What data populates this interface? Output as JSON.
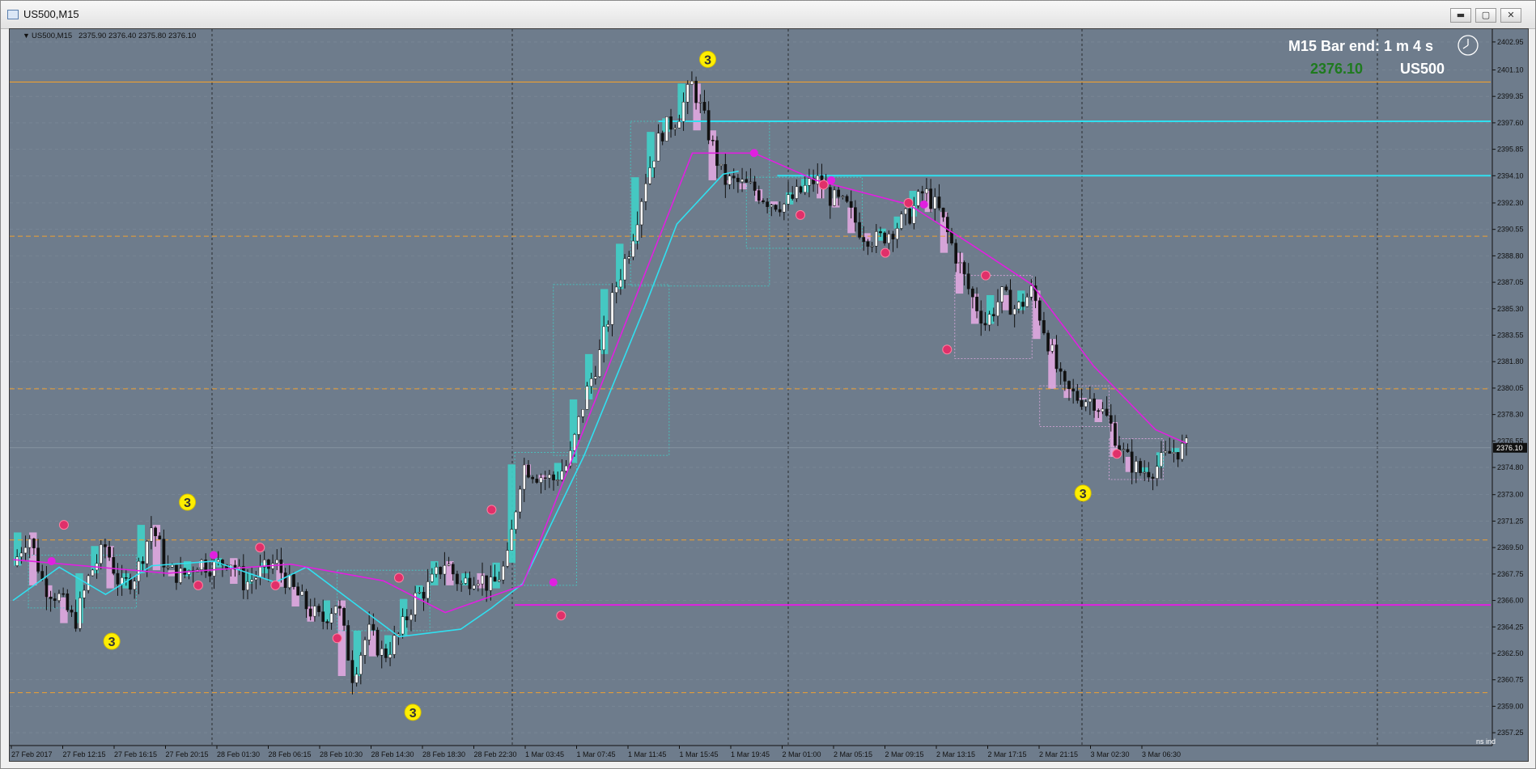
{
  "window": {
    "title": "US500,M15",
    "min_glyph": "▬",
    "max_glyph": "▢",
    "close_glyph": "✕"
  },
  "info_line": {
    "symbol": "US500,M15",
    "ohlc": "2375.90 2376.40 2375.80 2376.10"
  },
  "overlay": {
    "bar_end": "M15 Bar end: 1 m 4 s",
    "price": "2376.10",
    "symbol": "US500",
    "price_color": "#1e7a1e"
  },
  "corner_badge": "ns ind",
  "colors": {
    "background": "#6e7c8c",
    "bull": "#40d0c8",
    "bear": "#e0a8e0",
    "magenta": "#e020e0",
    "cyan": "#30e0f0",
    "orange": "#f0a030",
    "yellow": "#ffee00",
    "pivot": "#e0306a"
  },
  "chart_data": {
    "type": "candlestick",
    "title": "",
    "ylim": [
      2356.4,
      2403.8
    ],
    "y_ticks": [
      "2402.95",
      "2401.10",
      "2399.35",
      "2397.60",
      "2395.85",
      "2394.10",
      "2392.30",
      "2390.55",
      "2388.80",
      "2387.05",
      "2385.30",
      "2383.55",
      "2381.80",
      "2380.05",
      "2378.30",
      "2376.55",
      "2374.80",
      "2373.00",
      "2371.25",
      "2369.50",
      "2367.75",
      "2366.00",
      "2364.25",
      "2362.50",
      "2360.75",
      "2359.00",
      "2357.25"
    ],
    "current_price": "2376.10",
    "x_ticks": [
      "27 Feb 2017",
      "27 Feb 12:15",
      "27 Feb 16:15",
      "27 Feb 20:15",
      "28 Feb 01:30",
      "28 Feb 06:15",
      "28 Feb 10:30",
      "28 Feb 14:30",
      "28 Feb 18:30",
      "28 Feb 22:30",
      "1 Mar 03:45",
      "1 Mar 07:45",
      "1 Mar 11:45",
      "1 Mar 15:45",
      "1 Mar 19:45",
      "2 Mar 01:00",
      "2 Mar 05:15",
      "2 Mar 09:15",
      "2 Mar 13:15",
      "2 Mar 17:15",
      "2 Mar 21:15",
      "3 Mar 02:30",
      "3 Mar 06:30"
    ],
    "close_path": [
      [
        0,
        2368.3
      ],
      [
        1,
        2370.5
      ],
      [
        2,
        2367.0
      ],
      [
        3,
        2366.2
      ],
      [
        4,
        2364.5
      ],
      [
        5,
        2367.8
      ],
      [
        6,
        2369.6
      ],
      [
        7,
        2366.8
      ],
      [
        8,
        2367.8
      ],
      [
        9,
        2371.0
      ],
      [
        10,
        2368.0
      ],
      [
        11,
        2367.6
      ],
      [
        12,
        2368.6
      ],
      [
        13,
        2368.2
      ],
      [
        14,
        2368.8
      ],
      [
        15,
        2367.1
      ],
      [
        16,
        2367.8
      ],
      [
        17,
        2368.5
      ],
      [
        18,
        2366.9
      ],
      [
        19,
        2365.6
      ],
      [
        20,
        2364.6
      ],
      [
        21,
        2366.0
      ],
      [
        22,
        2361.0
      ],
      [
        23,
        2364.0
      ],
      [
        24,
        2362.3
      ],
      [
        25,
        2363.7
      ],
      [
        26,
        2366.1
      ],
      [
        27,
        2367.0
      ],
      [
        28,
        2368.6
      ],
      [
        29,
        2367.0
      ],
      [
        30,
        2367.8
      ],
      [
        31,
        2366.8
      ],
      [
        32,
        2368.5
      ],
      [
        33,
        2375.0
      ],
      [
        34,
        2374.3
      ],
      [
        35,
        2374.0
      ],
      [
        36,
        2375.1
      ],
      [
        37,
        2379.3
      ],
      [
        38,
        2382.3
      ],
      [
        39,
        2386.6
      ],
      [
        40,
        2389.6
      ],
      [
        41,
        2394.0
      ],
      [
        42,
        2397.0
      ],
      [
        43,
        2397.9
      ],
      [
        44,
        2400.2
      ],
      [
        45,
        2397.1
      ],
      [
        46,
        2393.8
      ],
      [
        47,
        2393.6
      ],
      [
        48,
        2393.2
      ],
      [
        49,
        2392.4
      ],
      [
        50,
        2392.2
      ],
      [
        51,
        2393.0
      ],
      [
        52,
        2393.9
      ],
      [
        53,
        2392.6
      ],
      [
        54,
        2392.0
      ],
      [
        55,
        2390.3
      ],
      [
        56,
        2389.8
      ],
      [
        57,
        2390.6
      ],
      [
        58,
        2391.4
      ],
      [
        59,
        2393.1
      ],
      [
        60,
        2391.7
      ],
      [
        61,
        2389.0
      ],
      [
        62,
        2386.3
      ],
      [
        63,
        2384.3
      ],
      [
        64,
        2386.2
      ],
      [
        65,
        2385.2
      ],
      [
        66,
        2386.5
      ],
      [
        67,
        2383.3
      ],
      [
        68,
        2380.0
      ],
      [
        69,
        2379.4
      ],
      [
        70,
        2379.3
      ],
      [
        71,
        2377.8
      ],
      [
        72,
        2375.5
      ],
      [
        73,
        2374.5
      ],
      [
        74,
        2374.8
      ],
      [
        75,
        2375.8
      ],
      [
        76,
        2376.1
      ]
    ],
    "n_steps": 76,
    "ma_magenta": [
      [
        0,
        2368.7
      ],
      [
        10,
        2367.8
      ],
      [
        18,
        2368.4
      ],
      [
        24,
        2367.3
      ],
      [
        28,
        2365.2
      ],
      [
        33,
        2367.0
      ],
      [
        44,
        2395.6
      ],
      [
        48,
        2395.6
      ],
      [
        52,
        2393.8
      ],
      [
        58,
        2392.2
      ],
      [
        62,
        2389.6
      ],
      [
        66,
        2386.9
      ],
      [
        70,
        2381.5
      ],
      [
        74,
        2377.3
      ],
      [
        76,
        2376.4
      ]
    ],
    "ma_cyan": [
      [
        0,
        2366.0
      ],
      [
        3,
        2368.2
      ],
      [
        6,
        2366.4
      ],
      [
        9,
        2368.3
      ],
      [
        13,
        2368.6
      ],
      [
        17,
        2367.2
      ],
      [
        19,
        2368.2
      ],
      [
        25,
        2363.6
      ],
      [
        29,
        2364.1
      ],
      [
        31,
        2365.5
      ],
      [
        33,
        2367.1
      ],
      [
        37,
        2375.6
      ],
      [
        41,
        2385.6
      ],
      [
        43,
        2390.9
      ],
      [
        46,
        2394.2
      ],
      [
        47,
        2394.4
      ]
    ],
    "hlines": [
      {
        "y": 2400.3,
        "color": "orange",
        "width": 1.2
      },
      {
        "y": 2397.7,
        "color": "cyan",
        "width": 2,
        "from": 41.8
      },
      {
        "y": 2394.1,
        "color": "cyan",
        "width": 2,
        "from": 49.5
      },
      {
        "y": 2365.7,
        "color": "magenta",
        "width": 2,
        "from": 32.5
      }
    ],
    "dashed_levels": [
      2390.1,
      2380.0,
      2370.0,
      2359.9
    ],
    "markers_three": [
      [
        6.4,
        2363.3
      ],
      [
        11.3,
        2372.5
      ],
      [
        25.9,
        2358.6
      ],
      [
        45.0,
        2401.8
      ],
      [
        69.3,
        2373.1
      ]
    ],
    "markers_pivot": [
      [
        3.3,
        2371.0
      ],
      [
        12.0,
        2367.0
      ],
      [
        16.0,
        2369.5
      ],
      [
        17.0,
        2367.0
      ],
      [
        21.0,
        2363.5
      ],
      [
        25.0,
        2367.5
      ],
      [
        31.0,
        2372.0
      ],
      [
        35.5,
        2365.0
      ],
      [
        52.5,
        2393.5
      ],
      [
        56.5,
        2389.0
      ],
      [
        51.0,
        2391.5
      ],
      [
        58.0,
        2392.3
      ],
      [
        60.5,
        2382.6
      ],
      [
        63.0,
        2387.5
      ],
      [
        71.5,
        2375.7
      ]
    ],
    "markers_magenta": [
      [
        2.5,
        2368.6
      ],
      [
        13.0,
        2369.0
      ],
      [
        35.0,
        2367.2
      ],
      [
        48.0,
        2395.6
      ],
      [
        53.0,
        2393.8
      ],
      [
        59.0,
        2392.2
      ]
    ]
  }
}
